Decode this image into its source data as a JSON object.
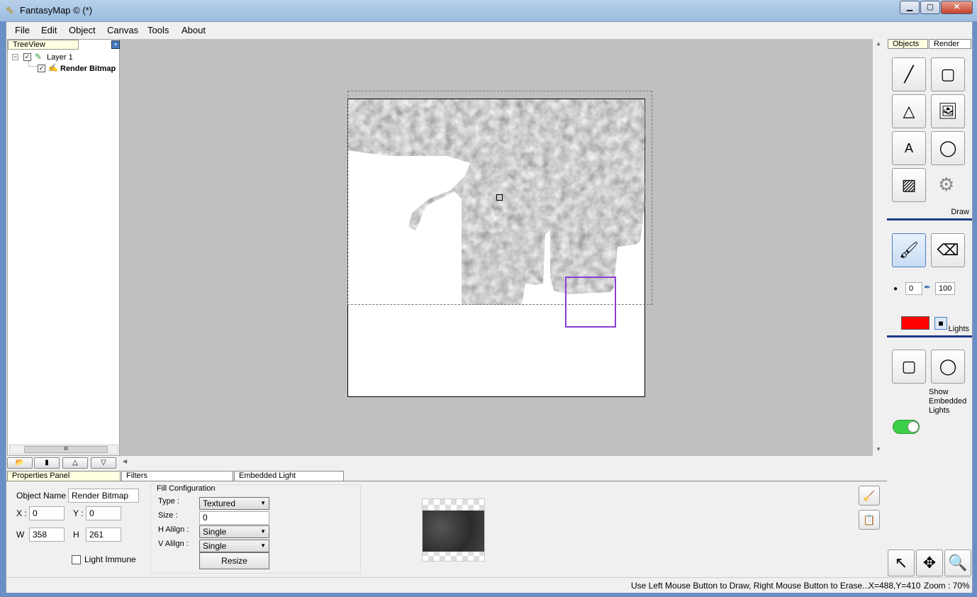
{
  "window": {
    "title": "FantasyMap © (*)"
  },
  "menu": [
    "File",
    "Edit",
    "Object",
    "Canvas",
    "Tools",
    "About"
  ],
  "treeview": {
    "tab": "TreeView",
    "items": [
      {
        "label": "Layer 1",
        "checked": true
      },
      {
        "label": "Render Bitmap",
        "checked": true
      }
    ]
  },
  "right_panel": {
    "tabs": [
      "Objects",
      "Render"
    ],
    "draw_label": "Draw",
    "lights_label": "Lights",
    "brush_min": "0",
    "brush_max": "100",
    "brush_color": "#ff0000",
    "show_embedded_lights": "Show Embedded Lights",
    "show_embedded_lights_on": true
  },
  "bottom_tabs": [
    "Properties Panel",
    "Filters",
    "Embedded Light"
  ],
  "properties": {
    "object_name_label": "Object Name",
    "object_name": "Render Bitmap",
    "x_label": "X :",
    "x": "0",
    "y_label": "Y :",
    "y": "0",
    "w_label": "W",
    "w": "358",
    "h_label": "H",
    "h": "261",
    "light_immune": "Light Immune",
    "fill": {
      "group": "Fill Configuration",
      "type_label": "Type :",
      "type": "Textured",
      "size_label": "Size :",
      "size": "0",
      "halign_label": "H Alilgn :",
      "halign": "Single",
      "valign_label": "V Alilgn :",
      "valign": "Single",
      "resize": "Resize"
    }
  },
  "status": {
    "hint": "Use Left Mouse Button to Draw, Right Mouse Button to Erase...",
    "coords": "X=488,Y=410",
    "zoom": "Zoom : 70%"
  }
}
